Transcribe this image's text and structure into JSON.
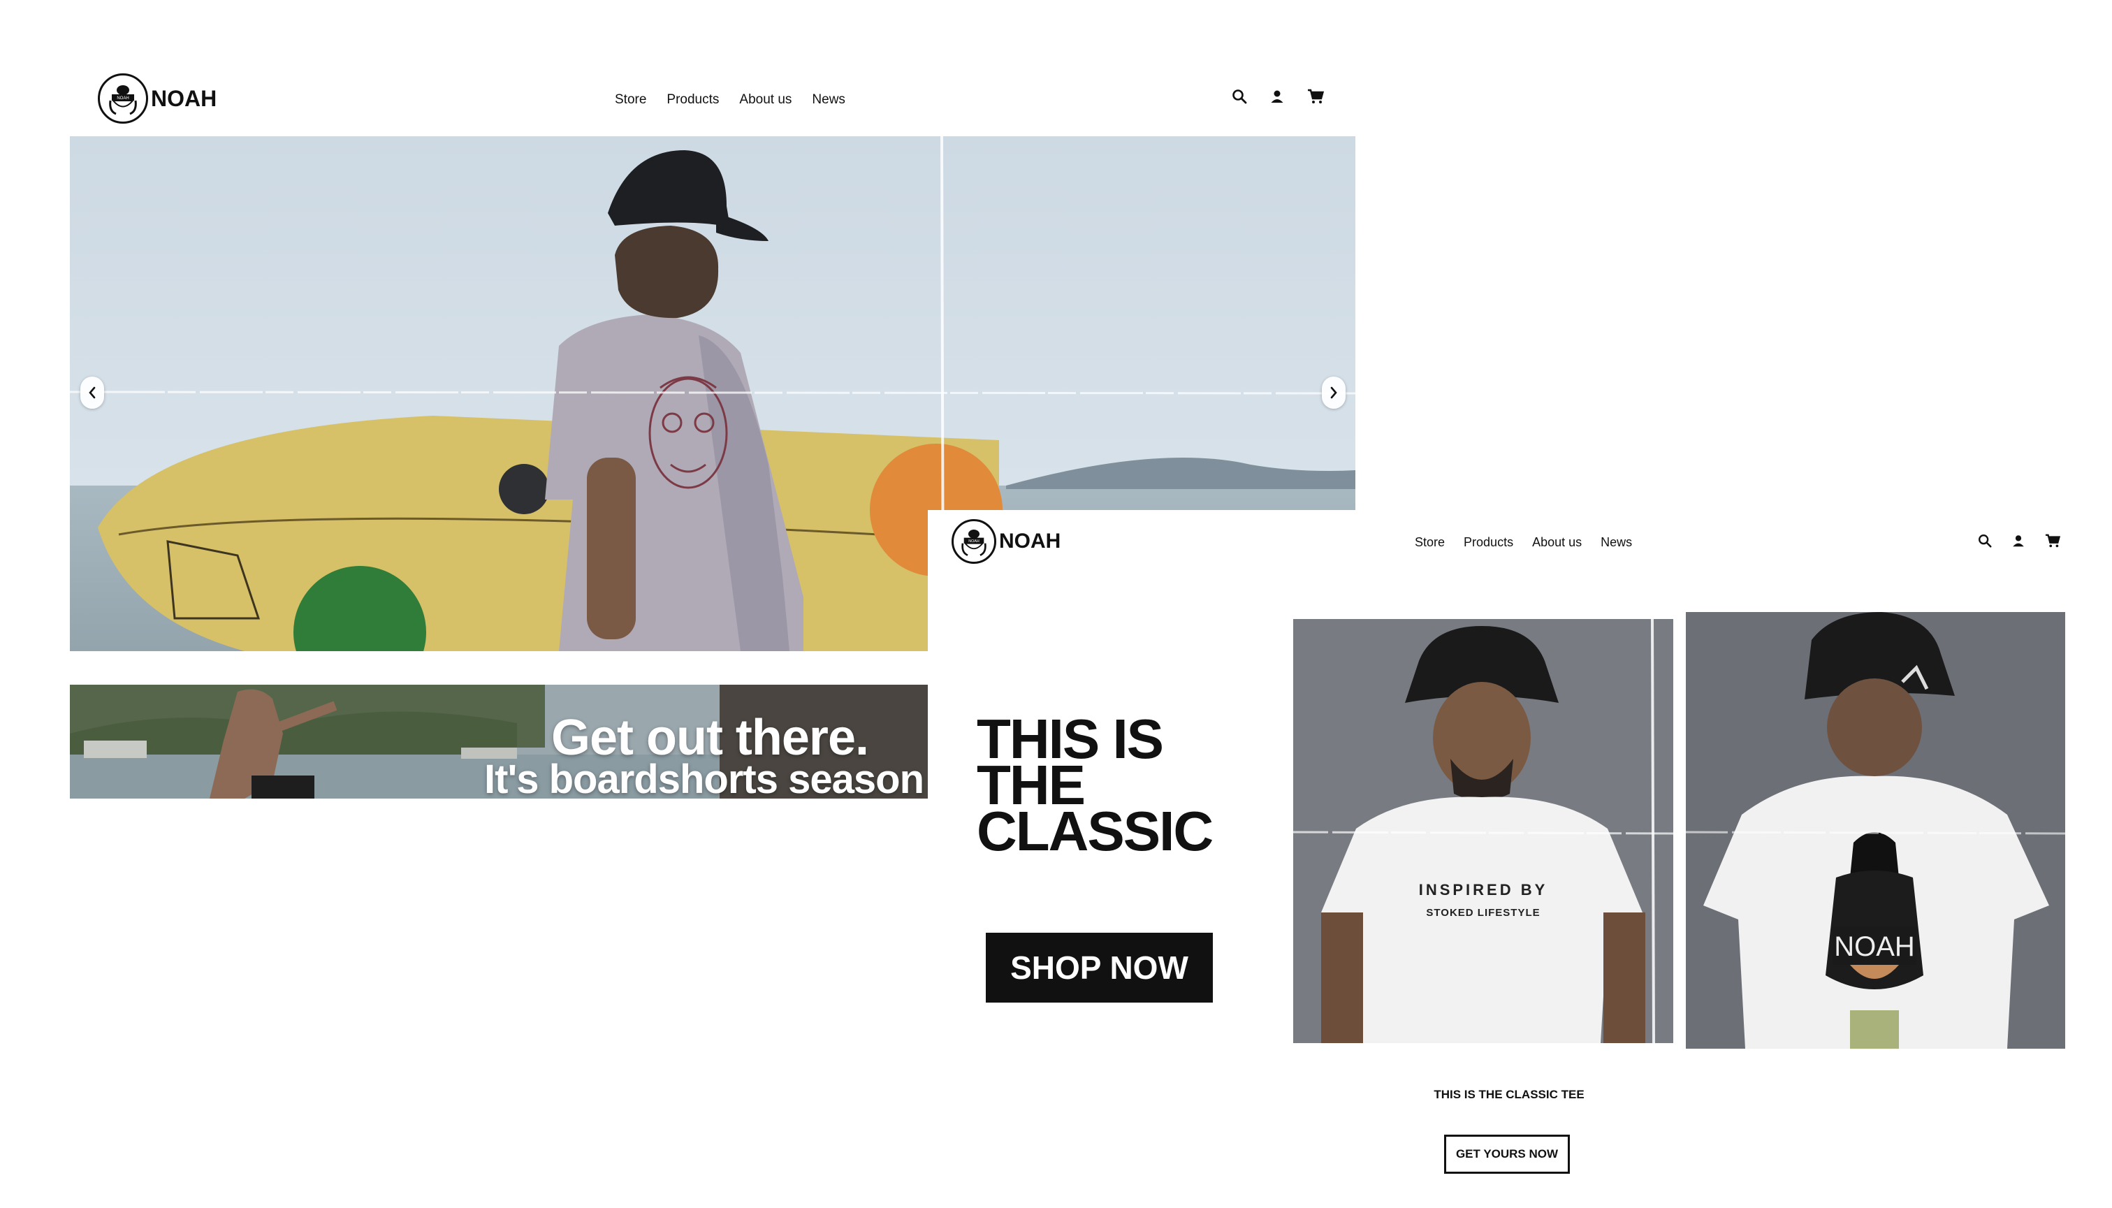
{
  "page1": {
    "brand": {
      "logo_text": "NOAH",
      "name": "NOAH"
    },
    "nav": [
      "Store",
      "Products",
      "About us",
      "News"
    ],
    "icons": [
      "search-icon",
      "account-icon",
      "cart-icon"
    ],
    "promo": {
      "title": "Get out there.",
      "subtitle": "It's boardshorts season"
    }
  },
  "page2": {
    "brand": {
      "logo_text": "NOAH",
      "name": "NOAH"
    },
    "nav": [
      "Store",
      "Products",
      "About us",
      "News"
    ],
    "icons": [
      "search-icon",
      "account-icon",
      "cart-icon"
    ],
    "heading": "THIS IS\nTHE\nCLASSIC",
    "shop_now": "SHOP NOW",
    "shirt_front_print": {
      "line1": "INSPIRED BY",
      "line2": "STOKED LIFESTYLE"
    },
    "shirt_back_print": "NOAH",
    "caption": "THIS IS THE CLASSIC TEE",
    "cta": "GET YOURS NOW"
  },
  "colors": {
    "text": "#111111",
    "background": "#ffffff",
    "button": "#111111"
  }
}
